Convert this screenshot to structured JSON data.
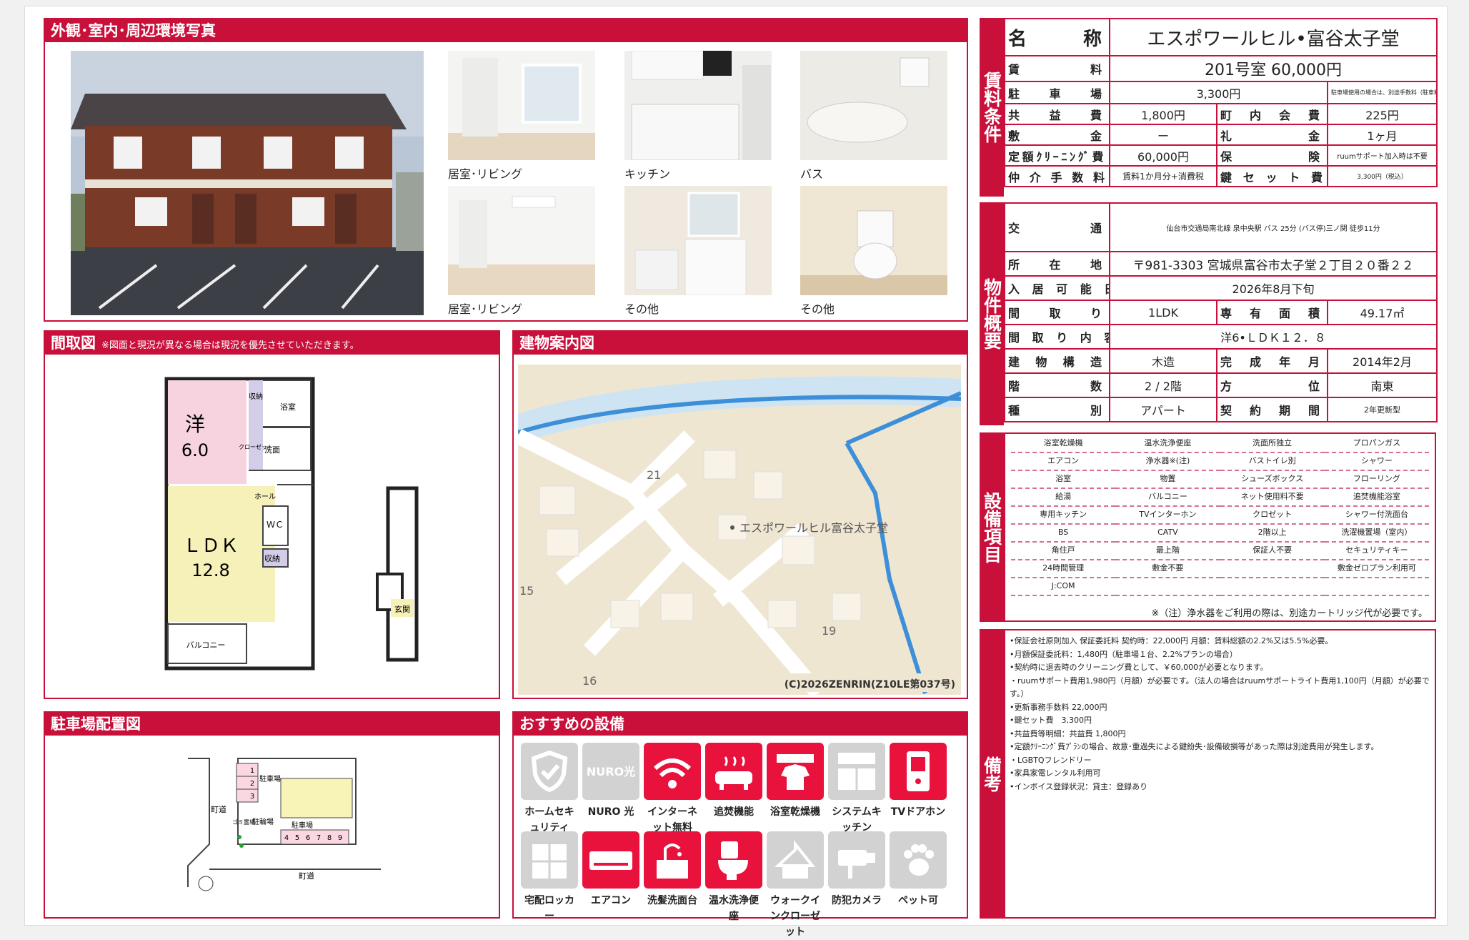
{
  "photos": {
    "title": "外観･室内･周辺環境写真",
    "captions": [
      "居室･リビング",
      "キッチン",
      "バス",
      "居室･リビング",
      "その他",
      "その他"
    ]
  },
  "floorplan": {
    "title": "間取図",
    "note": "※図面と現況が異なる場合は現況を優先させていただきます。",
    "room1_name": "洋",
    "room1_size": "6.0",
    "ldk_name": "ＬＤＫ",
    "ldk_size": "12.8",
    "labels": {
      "storage1": "収納",
      "closet": "クローゼット",
      "bath": "浴室",
      "washroom": "洗面",
      "hall": "ホール",
      "wc": "ＷＣ",
      "storage2": "収納",
      "balcony": "バルコニー",
      "entrance": "玄関"
    }
  },
  "map": {
    "title": "建物案内図",
    "building_label": "エスポワールヒル富谷太子堂",
    "numbers": [
      "21",
      "15",
      "19",
      "16"
    ],
    "copyright": "(C)2026ZENRIN(Z10LE第037号)"
  },
  "parking": {
    "title": "駐車場配置図",
    "labels": {
      "road_left": "町道",
      "road_bottom": "町道",
      "bike": "駐輪場",
      "parking_a": "駐車場",
      "parking_b": "駐車場",
      "garbage": "ゴミ置場"
    },
    "slots_a": [
      "1",
      "2",
      "3"
    ],
    "slots_b": [
      "4",
      "5",
      "6",
      "7",
      "8",
      "9"
    ]
  },
  "recommend": {
    "title": "おすすめの設備",
    "items": [
      {
        "label": "ホームセキュリティ",
        "on": false,
        "icon": "shield-icon"
      },
      {
        "label": "NURO 光",
        "on": false,
        "icon": "nuro-icon"
      },
      {
        "label": "インターネット無料",
        "on": true,
        "icon": "wifi-icon"
      },
      {
        "label": "追焚機能",
        "on": true,
        "icon": "bathtub-icon"
      },
      {
        "label": "浴室乾燥機",
        "on": true,
        "icon": "bath-dryer-icon"
      },
      {
        "label": "システムキッチン",
        "on": false,
        "icon": "kitchen-icon"
      },
      {
        "label": "TVドアホン",
        "on": true,
        "icon": "tv-doorphone-icon"
      },
      {
        "label": "宅配ロッカー",
        "on": false,
        "icon": "locker-icon"
      },
      {
        "label": "エアコン",
        "on": true,
        "icon": "aircon-icon"
      },
      {
        "label": "洗髪洗面台",
        "on": true,
        "icon": "washbasin-icon"
      },
      {
        "label": "温水洗浄便座",
        "on": true,
        "icon": "toilet-icon"
      },
      {
        "label": "ウォークインクローゼット",
        "on": false,
        "icon": "closet-icon"
      },
      {
        "label": "防犯カメラ",
        "on": false,
        "icon": "camera-icon"
      },
      {
        "label": "ペット可",
        "on": false,
        "icon": "paw-icon"
      }
    ]
  },
  "rent": {
    "side_label": "賃料条件",
    "name_label": "名 称",
    "name": "エスポワールヒル•富谷太子堂",
    "rent_label": "賃 料",
    "rent": "201号室 60,000円",
    "parking_label": "駐 車 場",
    "parking": "3,300円",
    "parking_note": "駐車場使用の場合は、別途手数料（駐車料+消費税）が必要です。",
    "common_label": "共 益 費",
    "common": "1,800円",
    "assoc_label": "町 内 会 費",
    "assoc": "225円",
    "deposit_label": "敷 金",
    "deposit": "ー",
    "keymoney_label": "礼 金",
    "keymoney": "1ヶ月",
    "cleaning_label": "定額ｸﾘｰﾆﾝｸﾞ費",
    "cleaning": "60,000円",
    "insurance_label": "保 険",
    "insurance": "ruumサポート加入時は不要",
    "broker_label": "仲 介 手 数 料",
    "broker": "賃料1か月分+消費税",
    "keyset_label": "鍵 セ ッ ト 費",
    "keyset": "3,300円（税込）"
  },
  "overview": {
    "side_label": "物件概要",
    "transport_label": "交 通",
    "transport": "仙台市交通局南北線 泉中央駅 バス 25分 (バス停)三ノ関 徒歩11分",
    "address_label": "所 在 地",
    "address": "〒981-3303 宮城県富谷市太子堂２丁目２０番２２",
    "available_label": "入 居 可 能 日",
    "available": "2026年8月下旬",
    "layout_label": "間 取 り",
    "layout": "1LDK",
    "area_label": "専 有 面 積",
    "area": "49.17㎡",
    "rooms_label": "間 取 り 内 容",
    "rooms": "洋6•ＬＤＫ１２．８",
    "structure_label": "建 物 構 造",
    "structure": "木造",
    "built_label": "完 成 年 月",
    "built": "2014年2月",
    "floor_label": "階 数",
    "floor": "2 / 2階",
    "direction_label": "方 位",
    "direction": "南東",
    "type_label": "種 別",
    "type": "アパート",
    "contract_label": "契 約 期 間",
    "contract": "2年更新型"
  },
  "equipment": {
    "side_label": "設備項目",
    "items": [
      "浴室乾燥機",
      "温水洗浄便座",
      "洗面所独立",
      "プロパンガス",
      "エアコン",
      "浄水器※(注)",
      "バストイレ別",
      "シャワー",
      "浴室",
      "物置",
      "シューズボックス",
      "フローリング",
      "給湯",
      "バルコニー",
      "ネット使用料不要",
      "追焚機能浴室",
      "専用キッチン",
      "TVインターホン",
      "クロゼット",
      "シャワー付洗面台",
      "BS",
      "CATV",
      "2階以上",
      "洗濯機置場（室内）",
      "角住戸",
      "最上階",
      "保証人不要",
      "セキュリティキー",
      "24時間管理",
      "敷金不要",
      "",
      "敷金ゼロプラン利用可",
      "J:COM",
      "",
      "",
      ""
    ],
    "note": "※（注）浄水器をご利用の際は、別途カートリッジ代が必要です。"
  },
  "remarks": {
    "side_label": "備考",
    "lines": [
      "•保証会社原則加入 保証委託料 契約時：22,000円 月額：賃料総額の2.2%又は5.5%必要。",
      "•月額保証委託料：1,480円（駐車場１台、2.2%プランの場合）",
      "•契約時に退去時のクリーニング費として、￥60,000が必要となります。",
      "・ruumサポート費用1,980円（月額）が必要です。（法人の場合はruumサポートライト費用1,100円（月額）が必要です。）",
      "•更新事務手数料 22,000円",
      "•鍵セット費　3,300円",
      "•共益費等明細：共益費 1,800円",
      "•定額ｸﾘｰﾆﾝｸﾞ費ﾌﾟﾗﾝの場合、故意･重過失による鍵紛失･設備破損等があった際は別途費用が発生します。",
      "・LGBTQフレンドリー",
      "•家具家電レンタル利用可",
      "•インボイス登録状況：貸主：登録あり"
    ]
  }
}
